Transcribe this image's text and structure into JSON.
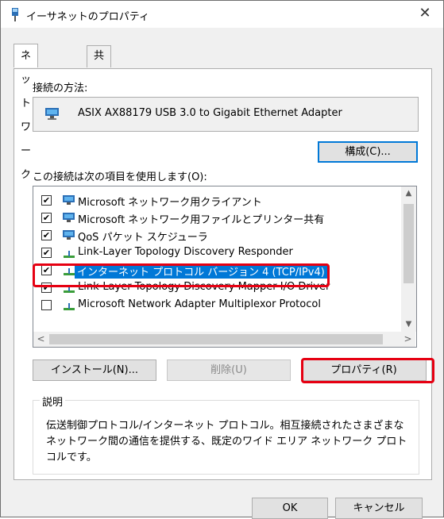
{
  "window": {
    "title": "イーサネットのプロパティ"
  },
  "tabs": [
    {
      "label": "ネットワーク"
    },
    {
      "label": "共有"
    }
  ],
  "connection": {
    "label": "接続の方法:",
    "adapter_name": "ASIX AX88179 USB 3.0 to Gigabit Ethernet Adapter",
    "configure_label": "構成(C)..."
  },
  "items": {
    "label": "この接続は次の項目を使用します(O):",
    "list": [
      {
        "label": "Microsoft ネットワーク用クライアント",
        "checked": true,
        "icon": "network-client-icon"
      },
      {
        "label": "Microsoft ネットワーク用ファイルとプリンター共有",
        "checked": true,
        "icon": "network-service-icon"
      },
      {
        "label": "QoS パケット スケジューラ",
        "checked": true,
        "icon": "network-service-icon"
      },
      {
        "label": "Link-Layer Topology Discovery Responder",
        "checked": true,
        "icon": "protocol-icon"
      },
      {
        "label": "インターネット プロトコル バージョン 4 (TCP/IPv4)",
        "checked": true,
        "icon": "protocol-icon",
        "selected": true
      },
      {
        "label": "Link-Layer Topology Discovery Mapper I/O Driver",
        "checked": true,
        "icon": "protocol-icon"
      },
      {
        "label": "Microsoft Network Adapter Multiplexor Protocol",
        "checked": false,
        "icon": "protocol-icon"
      }
    ]
  },
  "buttons": {
    "install": "インストール(N)...",
    "uninstall": "削除(U)",
    "properties": "プロパティ(R)",
    "ok": "OK",
    "cancel": "キャンセル"
  },
  "description": {
    "title": "説明",
    "text": "伝送制御プロトコル/インターネット プロトコル。相互接続されたさまざまなネットワーク間の通信を提供する、既定のワイド エリア ネットワーク プロトコルです。"
  },
  "colors": {
    "selection": "#0078d7",
    "highlight": "#e60012"
  }
}
